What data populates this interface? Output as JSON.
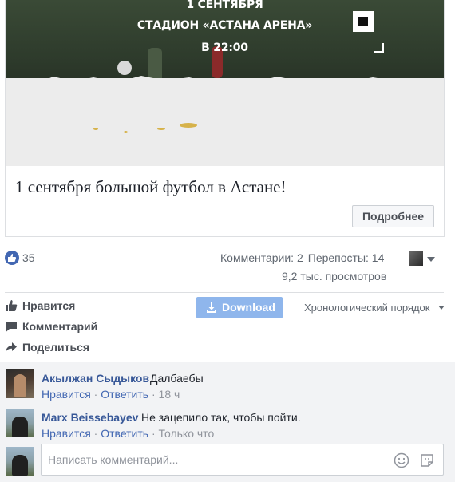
{
  "media": {
    "date_text": "1 СЕНТЯБРЯ",
    "venue_text": "СТАДИОН «АСТАНА АРЕНА»",
    "time_text": "В 22:00"
  },
  "post": {
    "title": "1 сентября большой футбол в Астане!",
    "more_button": "Подробнее"
  },
  "stats": {
    "likes": "35",
    "comments": "Комментарии: 2",
    "shares": "Перепосты: 14",
    "views": "9,2 тыс. просмотров"
  },
  "actions": {
    "like": "Нравится",
    "comment": "Комментарий",
    "share": "Поделиться",
    "download": "Download",
    "order": "Хронологический порядок"
  },
  "comments": [
    {
      "name": "Акылжан Сыдыков",
      "text": "Далбаебы",
      "like": "Нравится",
      "reply": "Ответить",
      "time": "18 ч",
      "sep": "·"
    },
    {
      "name": "Marx Beissebayev",
      "text": "Не зацепило так, чтобы пойти.",
      "like": "Нравится",
      "reply": "Ответить",
      "time": "Только что",
      "sep": "·"
    }
  ],
  "composer": {
    "placeholder": "Написать комментарий..."
  },
  "colors": {
    "link": "#385898",
    "accent": "#4267b2",
    "download_bg": "#8fb6ec",
    "comments_bg": "#f2f3f5"
  },
  "icons": [
    "like-icon",
    "comment-icon",
    "share-icon",
    "download-icon",
    "emoji-icon",
    "sticker-icon"
  ]
}
